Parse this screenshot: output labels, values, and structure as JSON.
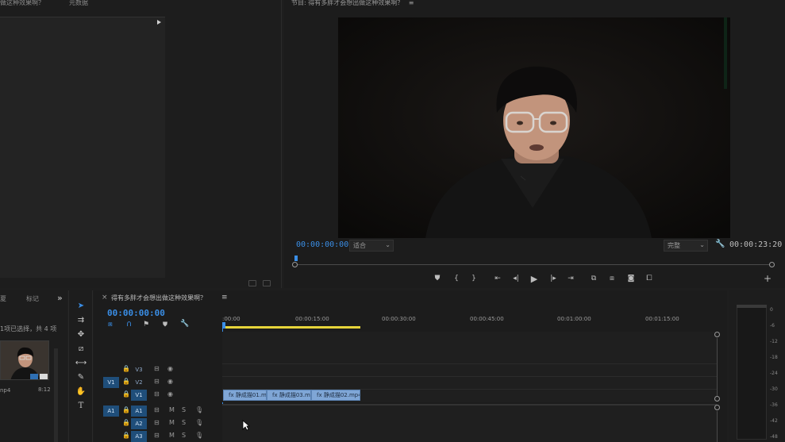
{
  "source": {
    "tab_source": "做这种效果啊？",
    "tab_metadata": "元数据"
  },
  "program": {
    "title": "节目: 得有多胖才会想出做这种效果啊？",
    "menu": "≡",
    "timecode_left": "00:00:00:00",
    "fit_label": "适合",
    "quality_label": "完整",
    "timecode_right": "00:00:23:20"
  },
  "bin": {
    "tab_left": "夏",
    "tab_markers": "标记",
    "overflow": "»",
    "selection_text": "1项已选择，共 4 项",
    "file_ext": "np4",
    "duration": "8:12"
  },
  "timeline": {
    "close": "×",
    "sequence_name": "得有多胖才会想出做这种效果啊？",
    "menu": "≡",
    "timecode": "00:00:00:00",
    "ruler": [
      ":00:00",
      "00:00:15:00",
      "00:00:30:00",
      "00:00:45:00",
      "00:01:00:00",
      "00:01:15:00"
    ],
    "tracks": {
      "v3": "V3",
      "v2": "V2",
      "v1": "V1",
      "a1": "A1",
      "a2": "A2",
      "a3": "A3",
      "src_v1": "V1",
      "src_a1": "A1",
      "m": "M",
      "s": "S"
    },
    "clips": [
      "静成描01.m",
      "静成描03.m",
      "静成描02.mp4"
    ]
  },
  "meters": {
    "scale": [
      "0",
      "-6",
      "-12",
      "-18",
      "-24",
      "-30",
      "-36",
      "-42",
      "-48"
    ]
  },
  "colors": {
    "accent_blue": "#3a8ee6",
    "clip_blue": "#7fa6d6",
    "work_area_yellow": "#e6d43a"
  }
}
